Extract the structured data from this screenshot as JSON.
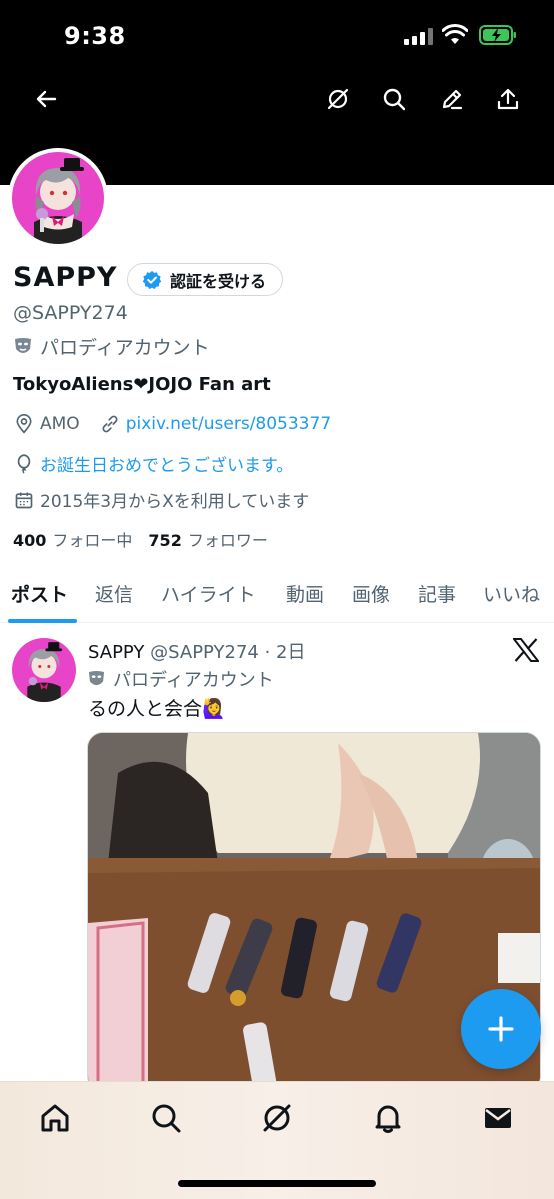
{
  "status_bar": {
    "time": "9:38"
  },
  "profile": {
    "name": "SAPPY",
    "verify_button": "認証を受ける",
    "handle": "@SAPPY274",
    "parody_label": "パロディアカウント",
    "bio": "TokyoAliens❤JOJO Fan art",
    "location": "AMO",
    "link": "pixiv.net/users/8053377",
    "birthday": "お誕生日おめでとうございます。",
    "joined": "2015年3月からXを利用しています",
    "following_count": "400",
    "following_label": "フォロー中",
    "followers_count": "752",
    "followers_label": "フォロワー"
  },
  "tabs": [
    {
      "label": "ポスト",
      "active": true
    },
    {
      "label": "返信"
    },
    {
      "label": "ハイライト"
    },
    {
      "label": "動画"
    },
    {
      "label": "画像"
    },
    {
      "label": "記事"
    },
    {
      "label": "いいね"
    }
  ],
  "post": {
    "name": "SAPPY",
    "handle_time": "@SAPPY274 · 2日",
    "parody_label": "パロディアカウント",
    "text": "るの人と会合🙋‍♀️"
  },
  "colors": {
    "accent": "#1d9bf0",
    "avatar_bg": "#e844c8",
    "header_bg": "#000000"
  },
  "icons": [
    "back-icon",
    "grok-icon",
    "search-icon",
    "edit-icon",
    "share-icon",
    "verified-badge-icon",
    "location-icon",
    "link-icon",
    "balloon-icon",
    "calendar-icon",
    "x-logo-icon",
    "compose-plus-icon",
    "home-icon",
    "notifications-icon",
    "messages-icon"
  ]
}
